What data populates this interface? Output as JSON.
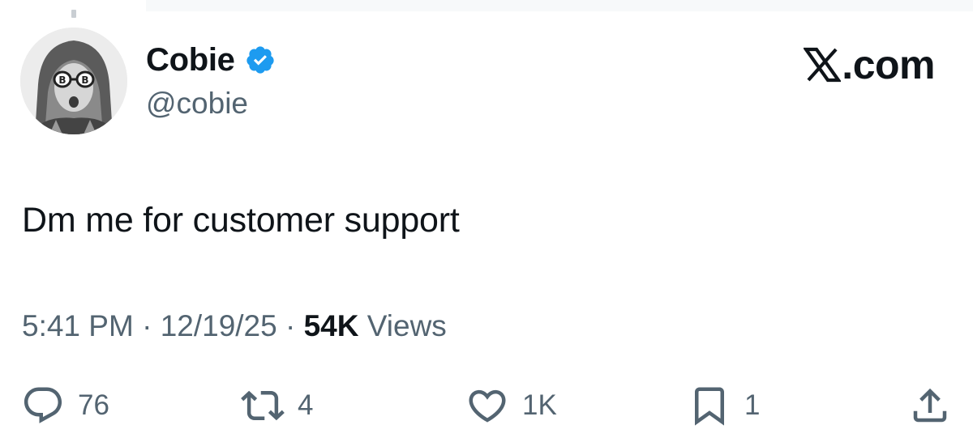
{
  "author": {
    "name": "Cobie",
    "handle": "@cobie",
    "verified": true,
    "avatar_icon": "avatar-photo-icon"
  },
  "brand": {
    "text": ".com",
    "mark_icon": "x-logo-icon"
  },
  "tweet": {
    "text": "Dm me for customer support"
  },
  "meta": {
    "time": "5:41 PM",
    "date": "12/19/25",
    "separator": "·",
    "views_count": "54K",
    "views_label": "Views"
  },
  "actions": {
    "reply": {
      "icon": "reply-icon",
      "count": "76"
    },
    "repost": {
      "icon": "repost-icon",
      "count": "4"
    },
    "like": {
      "icon": "heart-icon",
      "count": "1K"
    },
    "bookmark": {
      "icon": "bookmark-icon",
      "count": "1"
    },
    "share": {
      "icon": "share-icon"
    }
  },
  "colors": {
    "text_primary": "#0f1419",
    "text_secondary": "#536471",
    "verified_blue": "#1d9bf0"
  }
}
